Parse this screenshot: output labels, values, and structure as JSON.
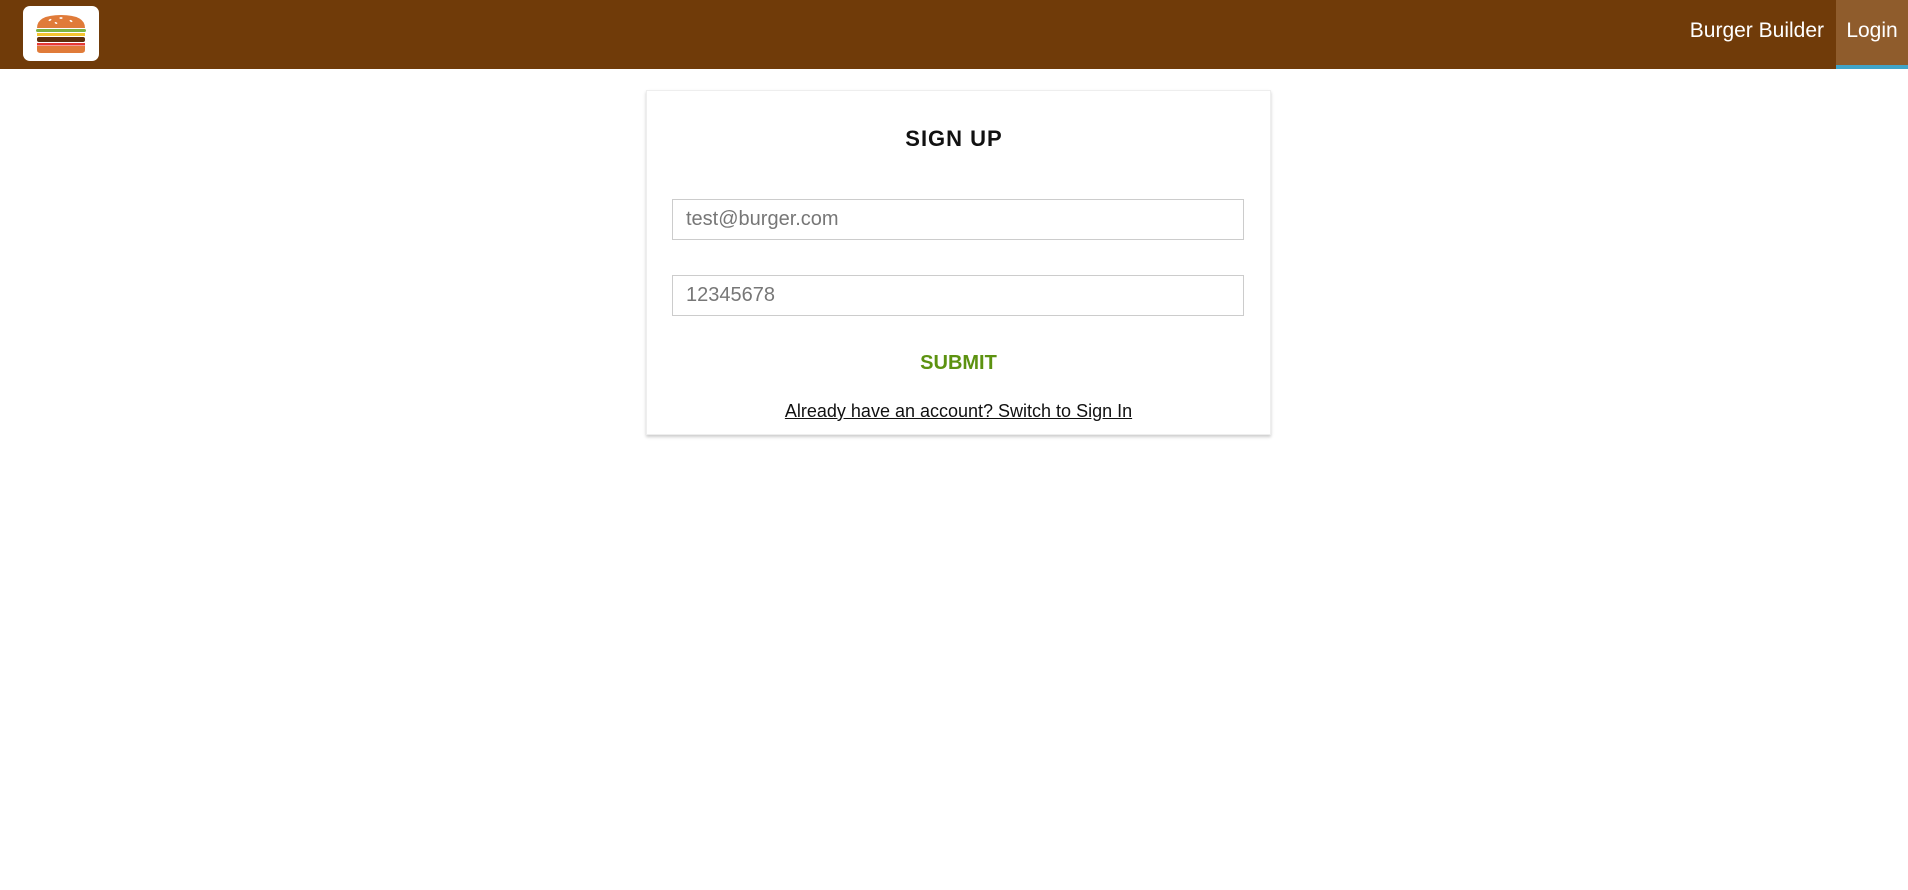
{
  "header": {
    "logo_icon": "burger-logo-icon",
    "nav": {
      "burger_builder": "Burger Builder",
      "login": "Login"
    },
    "colors": {
      "background": "#703B09",
      "active_item": "#8F5C2C",
      "active_indicator": "#40A4C8"
    }
  },
  "auth": {
    "title": "SIGN UP",
    "email_placeholder": "test@burger.com",
    "password_placeholder": "12345678",
    "submit_label": "SUBMIT",
    "switch_label": "Already have an account? Switch to Sign In",
    "submit_color": "#5C9210"
  }
}
